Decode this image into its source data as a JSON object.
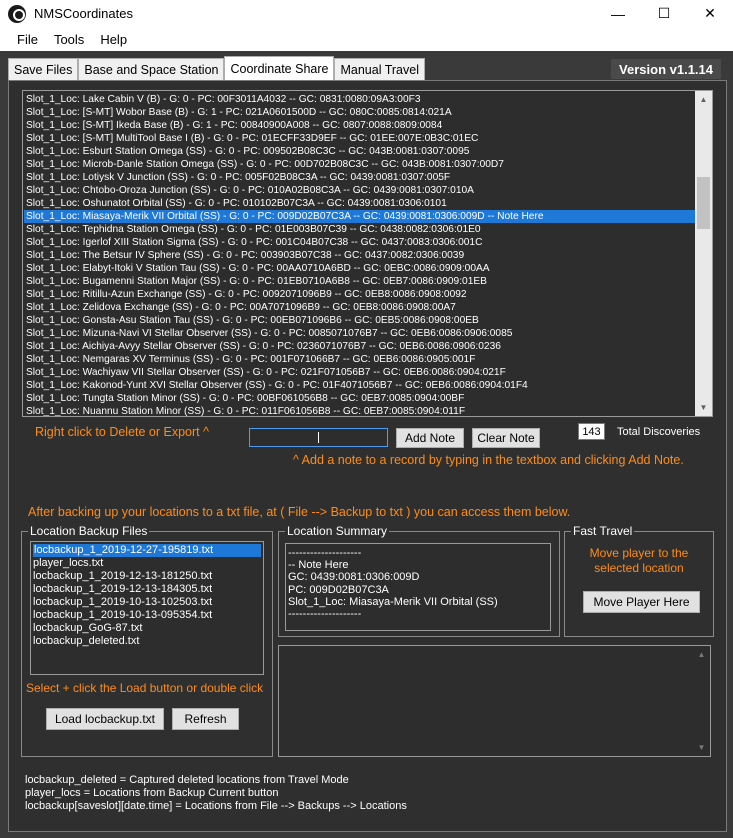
{
  "window": {
    "title": "NMSCoordinates",
    "controls": {
      "minimize": "—",
      "maximize": "☐",
      "close": "✕"
    }
  },
  "menu": [
    "File",
    "Tools",
    "Help"
  ],
  "tabs": [
    {
      "label": "Save Files",
      "active": false
    },
    {
      "label": "Base and Space Station",
      "active": false
    },
    {
      "label": "Coordinate Share",
      "active": true
    },
    {
      "label": "Manual Travel",
      "active": false
    }
  ],
  "version": "Version v1.1.14",
  "locations": [
    "Slot_1_Loc: Lake Cabin V (B) - G: 0 - PC: 00F3011A4032 -- GC: 0831:0080:09A3:00F3",
    "Slot_1_Loc: [S-MT] Wobor Base (B) - G: 1 - PC: 021A0601500D -- GC: 080C:0085:0814:021A",
    "Slot_1_Loc: [S-MT] Ikeda Base (B) - G: 1 - PC: 00840900A008 -- GC: 0807:0088:0809:0084",
    "Slot_1_Loc: [S-MT] MultiTool Base I (B) - G: 0 - PC: 01ECFF33D9EF -- GC: 01EE:007E:0B3C:01EC",
    "Slot_1_Loc: Esburt Station Omega (SS) - G: 0 - PC: 009502B08C3C -- GC: 043B:0081:0307:0095",
    "Slot_1_Loc: Microb-Danle Station Omega (SS) - G: 0 - PC: 00D702B08C3C -- GC: 043B:0081:0307:00D7",
    "Slot_1_Loc: Lotiysk V Junction (SS) - G: 0 - PC: 005F02B08C3A -- GC: 0439:0081:0307:005F",
    "Slot_1_Loc: Chtobo-Oroza Junction (SS) - G: 0 - PC: 010A02B08C3A -- GC: 0439:0081:0307:010A",
    "Slot_1_Loc: Oshunatot Orbital (SS) - G: 0 - PC: 010102B07C3A -- GC: 0439:0081:0306:0101",
    "Slot_1_Loc: Miasaya-Merik VII Orbital (SS) - G: 0 - PC: 009D02B07C3A -- GC: 0439:0081:0306:009D -- Note Here",
    "Slot_1_Loc: Tephidna Station Omega (SS) - G: 0 - PC: 01E003B07C39 -- GC: 0438:0082:0306:01E0",
    "Slot_1_Loc: Igerlof XIII Station Sigma (SS) - G: 0 - PC: 001C04B07C38 -- GC: 0437:0083:0306:001C",
    "Slot_1_Loc: The Betsur IV Sphere (SS) - G: 0 - PC: 003903B07C38 -- GC: 0437:0082:0306:0039",
    "Slot_1_Loc: Elabyt-Itoki V Station Tau (SS) - G: 0 - PC: 00AA0710A6BD -- GC: 0EBC:0086:0909:00AA",
    "Slot_1_Loc: Bugamenni Station Major (SS) - G: 0 - PC: 01EB0710A6B8 -- GC: 0EB7:0086:0909:01EB",
    "Slot_1_Loc: Ritillu-Azun Exchange (SS) - G: 0 - PC: 0092071096B9 -- GC: 0EB8:0086:0908:0092",
    "Slot_1_Loc: Zelidova Exchange (SS) - G: 0 - PC: 00A7071096B9 -- GC: 0EB8:0086:0908:00A7",
    "Slot_1_Loc: Gonsta-Asu Station Tau (SS) - G: 0 - PC: 00EB071096B6 -- GC: 0EB5:0086:0908:00EB",
    "Slot_1_Loc: Mizuna-Navi VI Stellar Observer (SS) - G: 0 - PC: 0085071076B7 -- GC: 0EB6:0086:0906:0085",
    "Slot_1_Loc: Aichiya-Avyy Stellar Observer (SS) - G: 0 - PC: 0236071076B7 -- GC: 0EB6:0086:0906:0236",
    "Slot_1_Loc: Nemgaras XV Terminus (SS) - G: 0 - PC: 001F071066B7 -- GC: 0EB6:0086:0905:001F",
    "Slot_1_Loc: Wachiyaw VII Stellar Observer (SS) - G: 0 - PC: 021F071056B7 -- GC: 0EB6:0086:0904:021F",
    "Slot_1_Loc: Kakonod-Yunt XVI Stellar Observer (SS) - G: 0 - PC: 01F4071056B7 -- GC: 0EB6:0086:0904:01F4",
    "Slot_1_Loc: Tungta Station Minor (SS) - G: 0 - PC: 00BF061056B8 -- GC: 0EB7:0085:0904:00BF",
    "Slot_1_Loc: Nuannu Station Minor (SS) - G: 0 - PC: 011F061056B8 -- GC: 0EB7:0085:0904:011F"
  ],
  "selected_location_index": 9,
  "hints": {
    "right_click": "Right click to Delete or Export ^",
    "add_note": "^ Add a note to a record by typing in the textbox and clicking Add Note.",
    "backup_info": "After backing up your locations to a txt file, at ( File --> Backup to txt ) you can access them below.",
    "select_load": "Select + click the Load button or double click"
  },
  "note_input": {
    "value": ""
  },
  "buttons": {
    "add_note": "Add Note",
    "clear_note": "Clear Note",
    "load_backup": "Load locbackup.txt",
    "refresh": "Refresh",
    "move_player": "Move Player Here"
  },
  "discoveries": {
    "count": "143",
    "label": "Total Discoveries"
  },
  "groups": {
    "backup_files": "Location Backup Files",
    "summary": "Location Summary",
    "fast_travel": "Fast Travel"
  },
  "backup_files": [
    "locbackup_1_2019-12-27-195819.txt",
    "player_locs.txt",
    "locbackup_1_2019-12-13-181250.txt",
    "locbackup_1_2019-12-13-184305.txt",
    "locbackup_1_2019-10-13-102503.txt",
    "locbackup_1_2019-10-13-095354.txt",
    "locbackup_GoG-87.txt",
    "locbackup_deleted.txt"
  ],
  "selected_backup_index": 0,
  "summary_lines": [
    "--------------------",
    " -- Note Here",
    "GC: 0439:0081:0306:009D",
    "PC: 009D02B07C3A",
    "Slot_1_Loc: Miasaya-Merik VII Orbital (SS)",
    "--------------------"
  ],
  "fast_travel_text": "Move player to the selected location",
  "legend": [
    "locbackup_deleted = Captured deleted locations from Travel Mode",
    "player_locs = Locations from Backup Current button",
    "locbackup[saveslot][date.time] = Locations from File --> Backups --> Locations"
  ],
  "colors": {
    "accent_orange": "#ff8c1a",
    "selection_blue": "#1e78d7",
    "panel_bg": "#2f2f2f"
  }
}
